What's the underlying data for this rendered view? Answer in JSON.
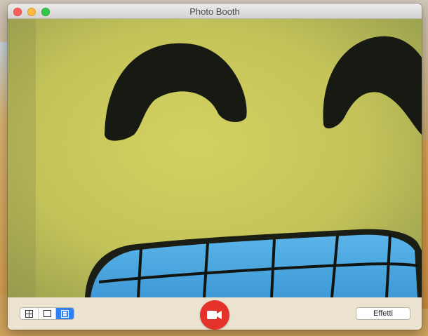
{
  "window": {
    "title": "Photo Booth"
  },
  "toolbar": {
    "layout_modes": [
      {
        "name": "four-photo-grid",
        "icon": "grid-icon",
        "selected": false
      },
      {
        "name": "single-photo",
        "icon": "square-icon",
        "selected": false
      },
      {
        "name": "video",
        "icon": "film-icon",
        "selected": true
      }
    ],
    "record_icon": "video-camera-icon",
    "effects_label": "Effetti"
  },
  "colors": {
    "record_button": "#e4322b",
    "selected_segment": "#2f80f0",
    "toolbar_bg": "#ebe3d0"
  }
}
